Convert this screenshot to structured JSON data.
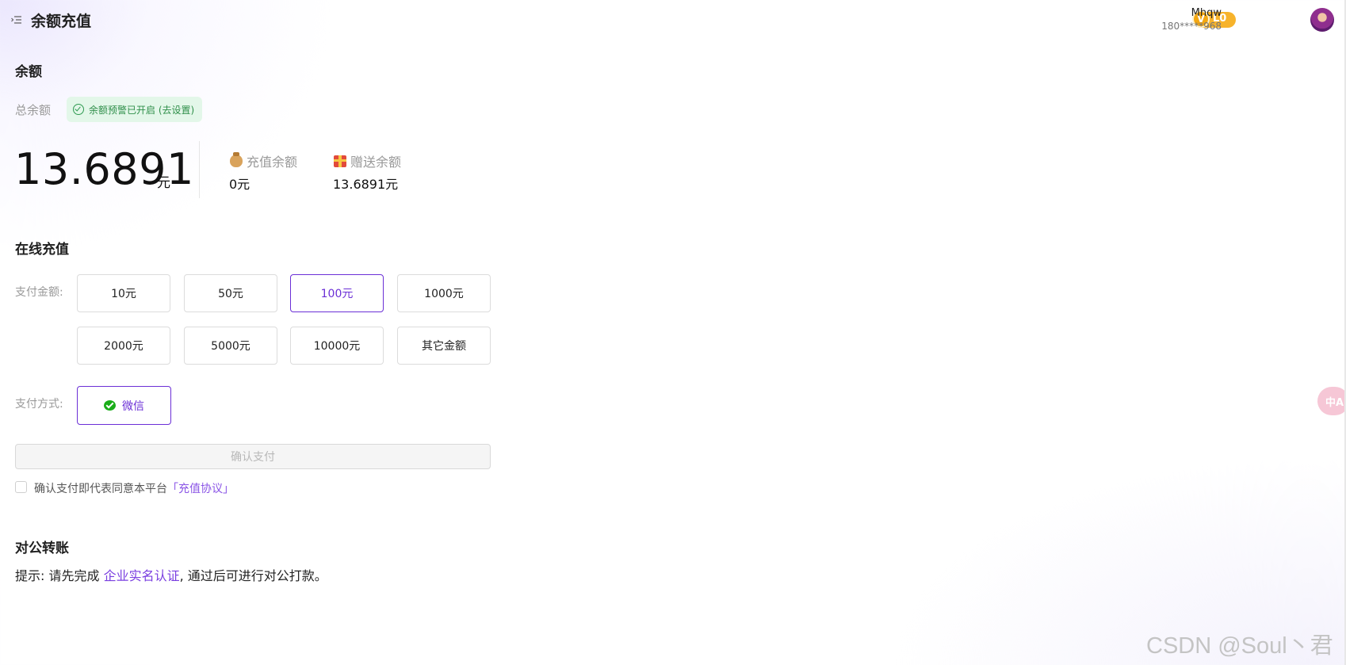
{
  "header": {
    "title": "余额充值",
    "level_badge": {
      "icon": "V",
      "level": "L0",
      "color": "#f7b32b"
    },
    "user": {
      "name": "Mhqw",
      "phone": "180*****968"
    }
  },
  "balance": {
    "section_title": "余额",
    "total_label": "总余额",
    "alert_text": "余额预警已开启 (去设置)",
    "total_amount": "13.6891",
    "unit": "元",
    "recharge_label": "充值余额",
    "recharge_value": "0元",
    "gift_label": "赠送余额",
    "gift_value": "13.6891元"
  },
  "online_recharge": {
    "section_title": "在线充值",
    "amount_label": "支付金额:",
    "amounts": [
      "10元",
      "50元",
      "100元",
      "1000元",
      "2000元",
      "5000元",
      "10000元",
      "其它金额"
    ],
    "selected_amount": "100元",
    "method_label": "支付方式:",
    "method": "微信",
    "confirm_label": "确认支付",
    "agree_text": "确认支付即代表同意本平台",
    "agree_link": "「充值协议」"
  },
  "public_transfer": {
    "section_title": "对公转账",
    "hint_prefix": "提示: 请先完成",
    "hint_link": "企业实名认证",
    "hint_suffix": ", 通过后可进行对公打款。"
  },
  "translate_label": "中A",
  "watermark": "CSDN @Soul丶君",
  "colors": {
    "accent": "#6b2fd6",
    "success_bg": "#e3f7e9",
    "success_text": "#2f8f4a",
    "badge": "#f7b32b"
  }
}
